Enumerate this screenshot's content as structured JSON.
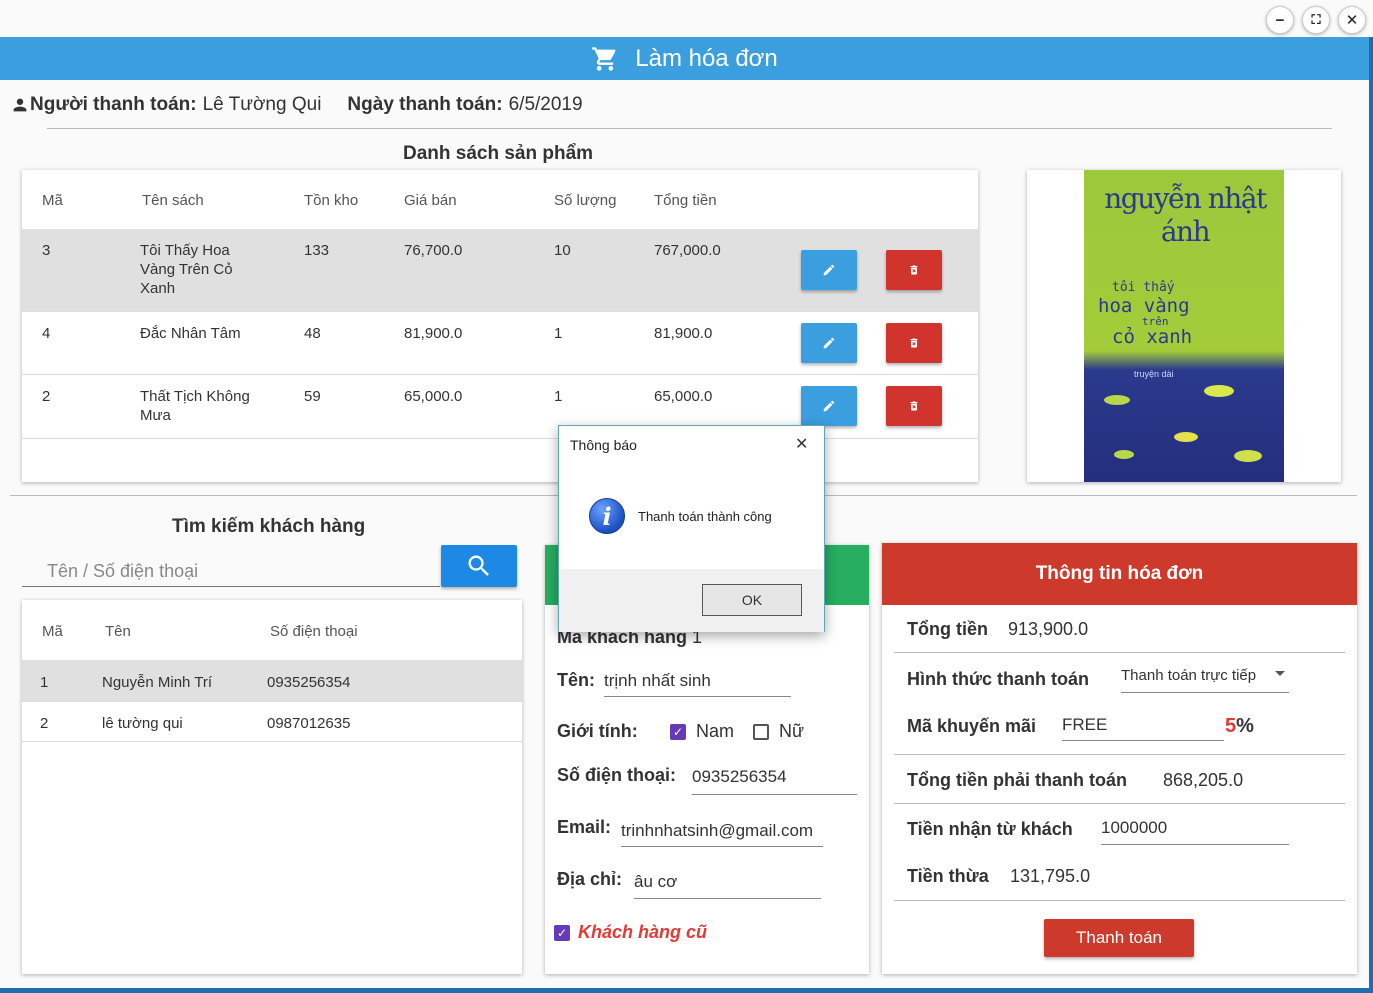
{
  "window": {
    "title": "Làm hóa đơn",
    "minimize": "−",
    "maximize": "⛶",
    "close": "✕"
  },
  "header": {
    "payer_label": "Người thanh toán:",
    "payer_value": "Lê Tường Qui",
    "date_label": "Ngày thanh toán:",
    "date_value": "6/5/2019"
  },
  "products": {
    "title": "Danh sách sản phẩm",
    "columns": [
      "Mã",
      "Tên sách",
      "Tồn kho",
      "Giá bán",
      "Số lượng",
      "Tổng tiền"
    ],
    "rows": [
      {
        "ma": "3",
        "ten": "Tôi Thấy Hoa Vàng Trên Cỏ Xanh",
        "ton": "133",
        "gia": "76,700.0",
        "sl": "10",
        "tong": "767,000.0"
      },
      {
        "ma": "4",
        "ten": "Đắc Nhân Tâm",
        "ton": "48",
        "gia": "81,900.0",
        "sl": "1",
        "tong": "81,900.0"
      },
      {
        "ma": "2",
        "ten": "Thất Tịch Không Mưa",
        "ton": "59",
        "gia": "65,000.0",
        "sl": "1",
        "tong": "65,000.0"
      }
    ]
  },
  "book_cover": {
    "author": "nguyễn nhật ánh",
    "title_lines": [
      "tôi thấy",
      "hoa vàng",
      "trên",
      "cỏ xanh"
    ],
    "subtitle": "truyện dài"
  },
  "customer_search": {
    "title": "Tìm kiếm khách hàng",
    "placeholder": "Tên / Số điện thoại",
    "columns": [
      "Mã",
      "Tên",
      "Số điện thoại"
    ],
    "rows": [
      {
        "ma": "1",
        "ten": "Nguyễn Minh Trí",
        "sdt": "0935256354"
      },
      {
        "ma": "2",
        "ten": "lê tường qui",
        "sdt": "0987012635"
      }
    ]
  },
  "customer_info": {
    "id_label": "Mã khách hàng",
    "id_value": "1",
    "name_label": "Tên:",
    "name_value": "trịnh nhất sinh",
    "gender_label": "Giới tính:",
    "gender_male": "Nam",
    "gender_female": "Nữ",
    "phone_label": "Số điện thoại:",
    "phone_value": "0935256354",
    "email_label": "Email:",
    "email_value": "trinhnhatsinh@gmail.com",
    "address_label": "Địa chỉ:",
    "address_value": "âu cơ",
    "old_customer": "Khách hàng cũ"
  },
  "invoice": {
    "title": "Thông tin hóa đơn",
    "total_label": "Tổng tiền",
    "total_value": "913,900.0",
    "payment_label": "Hình thức thanh toán",
    "payment_value": "Thanh toán trực tiếp",
    "promo_label": "Mã khuyến mãi",
    "promo_value": "FREE",
    "promo_percent": "5",
    "promo_percent_sign": "%",
    "pay_total_label": "Tổng tiền phải thanh toán",
    "pay_total_value": "868,205.0",
    "received_label": "Tiền nhận từ khách",
    "received_value": "1000000",
    "change_label": "Tiền thừa",
    "change_value": "131,795.0",
    "pay_button": "Thanh toán"
  },
  "dialog": {
    "title": "Thông báo",
    "message": "Thanh toán thành công",
    "ok": "OK",
    "close": "✕"
  },
  "colors": {
    "accent": "#3b9ede",
    "danger": "#d0342c",
    "success": "#27ae60",
    "purple": "#673ab7"
  }
}
